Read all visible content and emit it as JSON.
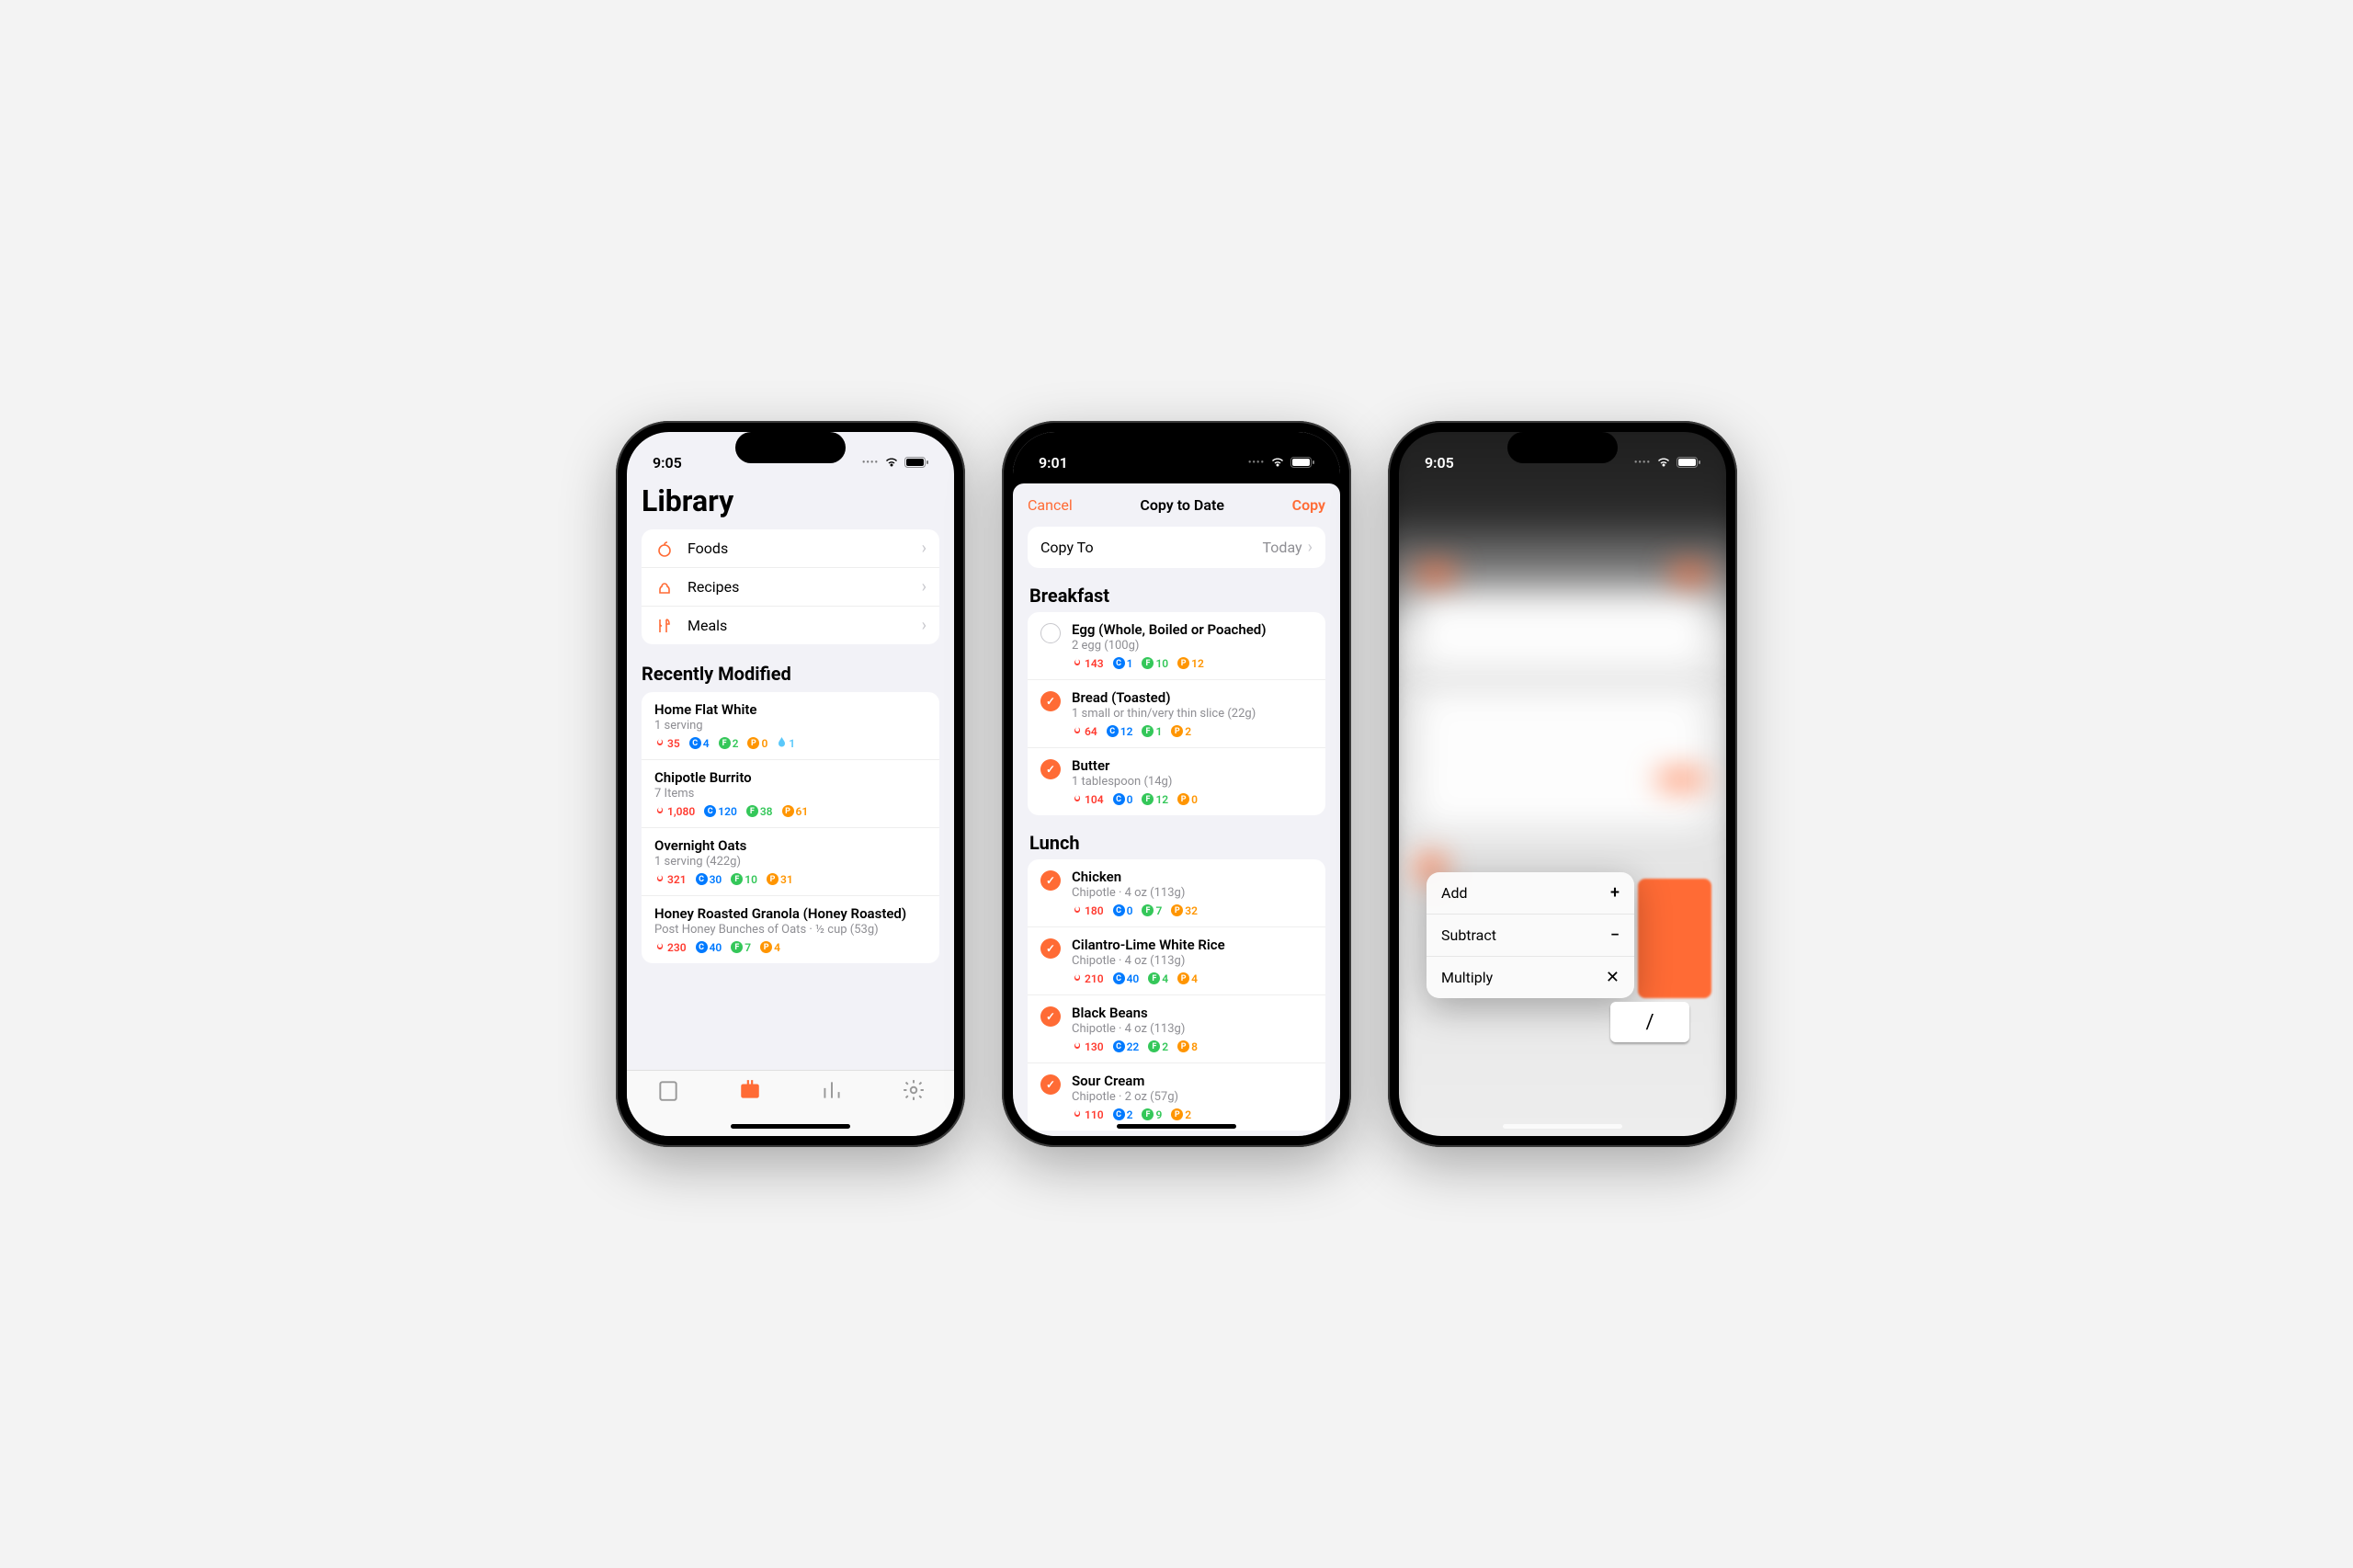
{
  "colors": {
    "accent": "#ff6b35",
    "carb": "#007aff",
    "fat": "#34c759",
    "protein": "#ff9500",
    "cal": "#ff3b30",
    "water": "#5ac8fa"
  },
  "phone1": {
    "time": "9:05",
    "title": "Library",
    "nav": [
      {
        "icon": "apple",
        "label": "Foods"
      },
      {
        "icon": "chef",
        "label": "Recipes"
      },
      {
        "icon": "utensils",
        "label": "Meals"
      }
    ],
    "recent_title": "Recently Modified",
    "recent": [
      {
        "name": "Home Flat White",
        "sub": "1 serving",
        "cal": "35",
        "carb": "4",
        "fat": "2",
        "pro": "0",
        "water": "1"
      },
      {
        "name": "Chipotle Burrito",
        "sub": "7 Items",
        "cal": "1,080",
        "carb": "120",
        "fat": "38",
        "pro": "61"
      },
      {
        "name": "Overnight Oats",
        "sub": "1 serving (422g)",
        "cal": "321",
        "carb": "30",
        "fat": "10",
        "pro": "31"
      },
      {
        "name": "Honey Roasted Granola (Honey Roasted)",
        "sub": "Post Honey Bunches of Oats · ½ cup (53g)",
        "cal": "230",
        "carb": "40",
        "fat": "7",
        "pro": "4"
      }
    ]
  },
  "phone2": {
    "time": "9:01",
    "cancel": "Cancel",
    "title": "Copy to Date",
    "copy": "Copy",
    "copy_to_label": "Copy To",
    "copy_to_value": "Today",
    "sections": [
      {
        "title": "Breakfast",
        "items": [
          {
            "checked": false,
            "name": "Egg (Whole, Boiled or Poached)",
            "sub": "2 egg (100g)",
            "cal": "143",
            "carb": "1",
            "fat": "10",
            "pro": "12"
          },
          {
            "checked": true,
            "name": "Bread (Toasted)",
            "sub": "1 small or thin/very thin slice (22g)",
            "cal": "64",
            "carb": "12",
            "fat": "1",
            "pro": "2"
          },
          {
            "checked": true,
            "name": "Butter",
            "sub": "1 tablespoon (14g)",
            "cal": "104",
            "carb": "0",
            "fat": "12",
            "pro": "0"
          }
        ]
      },
      {
        "title": "Lunch",
        "items": [
          {
            "checked": true,
            "name": "Chicken",
            "sub": "Chipotle · 4 oz (113g)",
            "cal": "180",
            "carb": "0",
            "fat": "7",
            "pro": "32"
          },
          {
            "checked": true,
            "name": "Cilantro-Lime White Rice",
            "sub": "Chipotle · 4 oz (113g)",
            "cal": "210",
            "carb": "40",
            "fat": "4",
            "pro": "4"
          },
          {
            "checked": true,
            "name": "Black Beans",
            "sub": "Chipotle · 4 oz (113g)",
            "cal": "130",
            "carb": "22",
            "fat": "2",
            "pro": "8"
          },
          {
            "checked": true,
            "name": "Sour Cream",
            "sub": "Chipotle · 2 oz (57g)",
            "cal": "110",
            "carb": "2",
            "fat": "9",
            "pro": "2"
          }
        ]
      }
    ]
  },
  "phone3": {
    "time": "9:05",
    "menu": [
      {
        "label": "Add",
        "symbol": "+"
      },
      {
        "label": "Subtract",
        "symbol": "−"
      },
      {
        "label": "Multiply",
        "symbol": "✕"
      }
    ],
    "key_label": "/"
  }
}
